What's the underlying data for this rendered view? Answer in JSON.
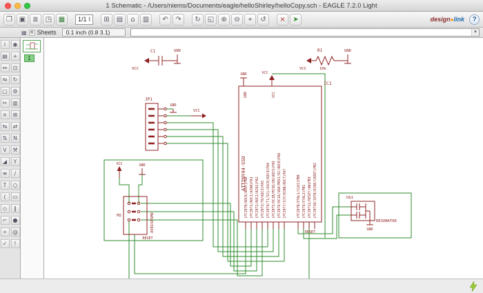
{
  "window": {
    "title": "1 Schematic - /Users/niems/Documents/eagle/helloShirley/helloCopy.sch - EAGLE 7.2.0 Light"
  },
  "toolbar": {
    "sheet_selector": "1/1",
    "spin_up": "▴",
    "spin_down": "▾",
    "groups": {
      "file": [
        {
          "name": "open",
          "glyph": "❒"
        },
        {
          "name": "save",
          "glyph": "▣"
        },
        {
          "name": "print",
          "glyph": "≣"
        },
        {
          "name": "cam-processor",
          "glyph": "◳"
        },
        {
          "name": "switch-to-board",
          "glyph": "▦",
          "color": "#3a7d3a"
        }
      ],
      "view": [
        {
          "name": "grid",
          "glyph": "⊞"
        },
        {
          "name": "layer-settings",
          "glyph": "▤"
        },
        {
          "name": "use-library",
          "glyph": "⌂"
        },
        {
          "name": "run-script",
          "glyph": "▥"
        }
      ],
      "edit": [
        {
          "name": "undo",
          "glyph": "↶"
        },
        {
          "name": "redo",
          "glyph": "↷"
        }
      ],
      "zoom": [
        {
          "name": "redraw",
          "glyph": "↻"
        },
        {
          "name": "zoom-fit",
          "glyph": "◱"
        },
        {
          "name": "zoom-in",
          "glyph": "⊕"
        },
        {
          "name": "zoom-out",
          "glyph": "⊖"
        },
        {
          "name": "zoom-select",
          "glyph": "⌖"
        },
        {
          "name": "zoom-last",
          "glyph": "↺"
        }
      ],
      "run": [
        {
          "name": "stop",
          "glyph": "×",
          "color": "#b03030"
        },
        {
          "name": "go",
          "glyph": "➤",
          "color": "#2e8b2e"
        }
      ]
    },
    "brand": {
      "part1": "design",
      "dot": "●",
      "part2": "link"
    },
    "help_label": "?"
  },
  "subbar": {
    "panel_icon_glyph": "▦",
    "close_glyph": "✕",
    "panel_tab": "Sheets",
    "coordinates": "0.1 inch (0.8 3.1)",
    "command_value": "",
    "dropdown_glyph": "▾"
  },
  "palette": {
    "tools": [
      {
        "name": "info",
        "glyph": "i"
      },
      {
        "name": "show",
        "glyph": "◉"
      },
      {
        "name": "display",
        "glyph": "▤"
      },
      {
        "name": "mark",
        "glyph": "+"
      },
      {
        "name": "move",
        "glyph": "↔"
      },
      {
        "name": "copy",
        "glyph": "⊡"
      },
      {
        "name": "mirror",
        "glyph": "⇋"
      },
      {
        "name": "rotate",
        "glyph": "↻"
      },
      {
        "name": "group",
        "glyph": "▢"
      },
      {
        "name": "change",
        "glyph": "⚙"
      },
      {
        "name": "cut",
        "glyph": "✂"
      },
      {
        "name": "paste",
        "glyph": "▥"
      },
      {
        "name": "delete",
        "glyph": "×"
      },
      {
        "name": "add",
        "glyph": "⊞"
      },
      {
        "name": "pinswap",
        "glyph": "⇆"
      },
      {
        "name": "replace",
        "glyph": "⇄"
      },
      {
        "name": "gateswap",
        "glyph": "⇅"
      },
      {
        "name": "name",
        "glyph": "N"
      },
      {
        "name": "value",
        "glyph": "V"
      },
      {
        "name": "smash",
        "glyph": "⚒"
      },
      {
        "name": "miter",
        "glyph": "◢"
      },
      {
        "name": "split",
        "glyph": "Y"
      },
      {
        "name": "invoke",
        "glyph": "≡"
      },
      {
        "name": "wire",
        "glyph": "∕"
      },
      {
        "name": "text",
        "glyph": "T"
      },
      {
        "name": "circle",
        "glyph": "○"
      },
      {
        "name": "arc",
        "glyph": "("
      },
      {
        "name": "rect",
        "glyph": "▭"
      },
      {
        "name": "polygon",
        "glyph": "◇"
      },
      {
        "name": "bus",
        "glyph": "∥"
      },
      {
        "name": "net",
        "glyph": "⌐"
      },
      {
        "name": "junction",
        "glyph": "●"
      },
      {
        "name": "label",
        "glyph": "⌖"
      },
      {
        "name": "attribute",
        "glyph": "@"
      },
      {
        "name": "erc",
        "glyph": "✓"
      },
      {
        "name": "errors",
        "glyph": "!"
      }
    ]
  },
  "sheets_panel": {
    "sheet_number": "1"
  },
  "schematic": {
    "colors": {
      "symbol_color": "#8e2020",
      "net_color": "#2e8b2e"
    },
    "c1": {
      "ref": "C1",
      "vcc": "VCC",
      "gnd": "GND"
    },
    "r1": {
      "ref": "R1",
      "value": "10k",
      "vcc": "VCC",
      "gnd": "GND"
    },
    "jp1": {
      "ref": "JP1",
      "gnd": "GND",
      "vcc": "VCC"
    },
    "ic1": {
      "ref": "IC1",
      "part": "ATTINY44-SSU",
      "gnd": "GND",
      "vcc": "VCC",
      "pins": [
        "(PCINT0/ADC0/AREF)PA0",
        "(PCINT1/ADC1/AIN0)PA1",
        "(PCINT2/ADC2/AIN1)PA2",
        "(PCINT3/T0/ADC3)PA3",
        "(PCINT4/T1/SCL/USCK/ADC4)PA4",
        "(PCINT5/OC1B/MISO/DO/ADC5)PA5",
        "(PCINT6/OC1A/SDA/MOSI/DI/ADC6)PA6",
        "(PCINT7/ICP/OC0B/ADC7)PA7",
        "(PCINT8/XTAL1/CLKI)PB0",
        "(PCINT9/XTAL2)PB1",
        "(PCINT11/RESET/dW)PB3",
        "(PCINT10/INT0/OC0A/CKOUT)PB2"
      ]
    },
    "m2": {
      "ref": "M2",
      "part": "AVRISPSMD",
      "vcc": "VCC",
      "gnd": "GND",
      "reset": "RESET"
    },
    "res": {
      "ref": "U$1",
      "part": "RESONATOR",
      "gnd": "GND"
    },
    "net_labels": {
      "reset": "RESET"
    }
  },
  "statusbar": {
    "activity_icon": "bolt"
  }
}
